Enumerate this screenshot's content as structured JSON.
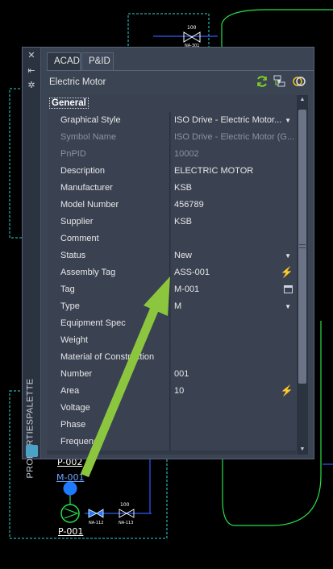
{
  "palette": {
    "title": "PROPERTIESPALETTE",
    "tabs": [
      {
        "label": "ACAD",
        "active": false
      },
      {
        "label": "P&ID",
        "active": true
      }
    ],
    "selector": {
      "value": "Electric Motor"
    },
    "category": "General",
    "properties": [
      {
        "name": "Graphical Style",
        "value": "ISO Drive - Electric Motor...",
        "control": "dropdown",
        "enabled": true
      },
      {
        "name": "Symbol Name",
        "value": "ISO Drive - Electric Motor (G...",
        "control": "none",
        "enabled": false
      },
      {
        "name": "PnPID",
        "value": "10002",
        "control": "none",
        "enabled": false
      },
      {
        "name": "Description",
        "value": "ELECTRIC MOTOR",
        "control": "none",
        "enabled": true
      },
      {
        "name": "Manufacturer",
        "value": "KSB",
        "control": "none",
        "enabled": true
      },
      {
        "name": "Model Number",
        "value": "456789",
        "control": "none",
        "enabled": true
      },
      {
        "name": "Supplier",
        "value": "KSB",
        "control": "none",
        "enabled": true
      },
      {
        "name": "Comment",
        "value": "",
        "control": "none",
        "enabled": true
      },
      {
        "name": "Status",
        "value": "New",
        "control": "dropdown",
        "enabled": true
      },
      {
        "name": "Assembly Tag",
        "value": "ASS-001",
        "control": "bolt",
        "enabled": true
      },
      {
        "name": "Tag",
        "value": "M-001",
        "control": "window",
        "enabled": true
      },
      {
        "name": "Type",
        "value": "M",
        "control": "dropdown",
        "enabled": true
      },
      {
        "name": "Equipment Spec",
        "value": "",
        "control": "none",
        "enabled": true
      },
      {
        "name": "Weight",
        "value": "",
        "control": "none",
        "enabled": true
      },
      {
        "name": "Material of Construction",
        "value": "",
        "control": "none",
        "enabled": true
      },
      {
        "name": "Number",
        "value": "001",
        "control": "none",
        "enabled": true
      },
      {
        "name": "Area",
        "value": "10",
        "control": "bolt",
        "enabled": true
      },
      {
        "name": "Voltage",
        "value": "",
        "control": "none",
        "enabled": true
      },
      {
        "name": "Phase",
        "value": "",
        "control": "none",
        "enabled": true
      },
      {
        "name": "Frequency",
        "value": "",
        "control": "none",
        "enabled": true
      }
    ],
    "icons": {
      "close": "close-icon",
      "autohide": "auto-hide-icon",
      "settings": "settings-icon",
      "refresh": "refresh-icon",
      "filter": "filter-icon",
      "compare": "toggle-pickadd-icon"
    }
  },
  "cad": {
    "labels": {
      "p002": "P-002",
      "m001": "M-001",
      "p001": "P-001",
      "valve_top_number": "100",
      "valve_top_tag": "NA-301",
      "valve1_tag": "NA-112",
      "valve2_tag": "NA-113",
      "valve2_number": "100"
    },
    "colors": {
      "frame": "#2fd6d6",
      "vessel": "#29e04a",
      "line": "#2a5cff",
      "highlight": "#1e7bff",
      "arrow": "#8cc63f"
    }
  }
}
